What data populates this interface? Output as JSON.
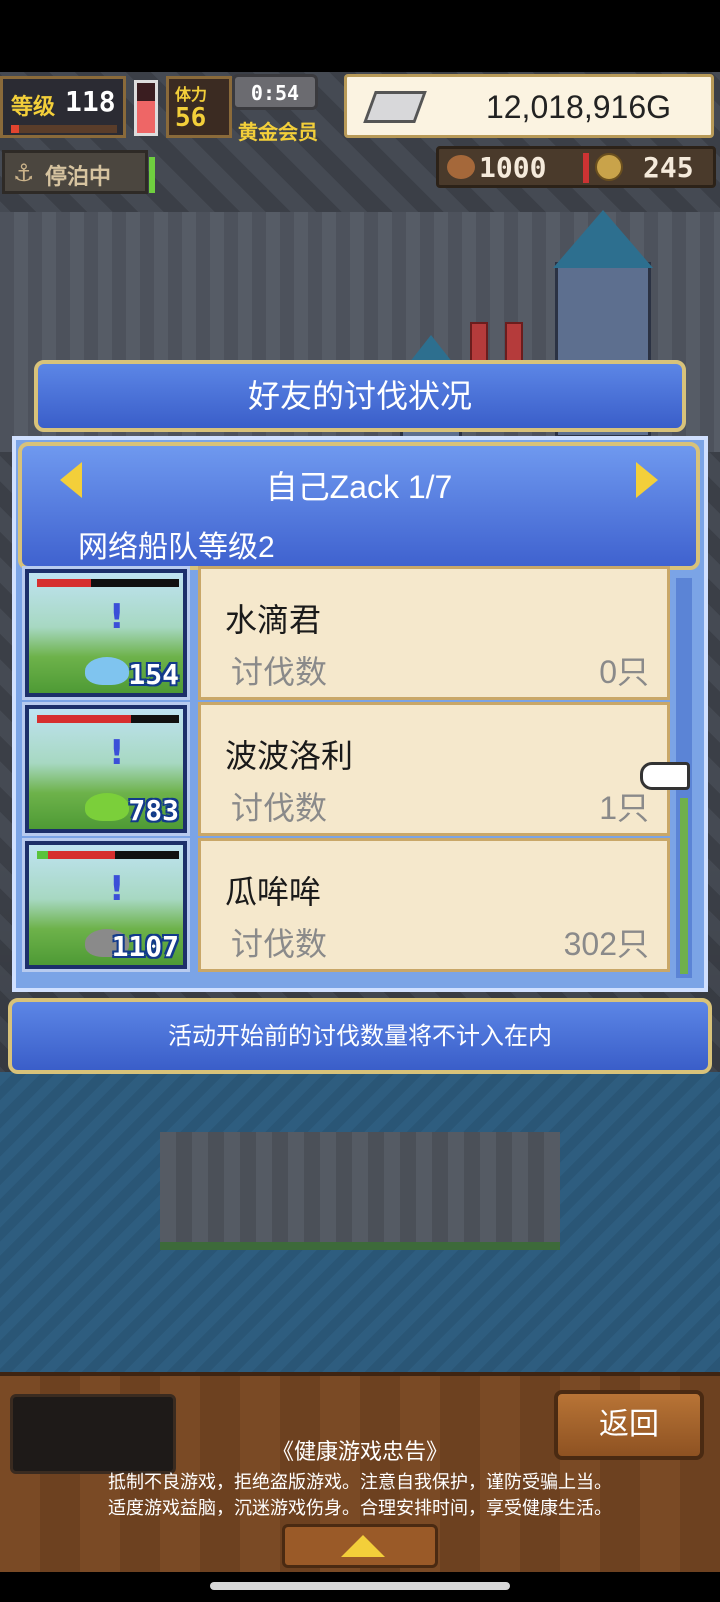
{
  "hud": {
    "level_label": "等级",
    "level": "118",
    "level_progress": 0.08,
    "stamina_level": 0.65,
    "vip_top": "体力",
    "vip_value": "56",
    "timer": "0:54",
    "membership": "黄金会员",
    "money": "12,018,916G"
  },
  "status": {
    "moored_icon": "anchor-icon",
    "moored": "停泊中"
  },
  "resources": {
    "food_icon": "fish-icon",
    "food": "1000",
    "coin_icon": "medal-icon",
    "coins": "245"
  },
  "dialog": {
    "title": "好友的讨伐状况",
    "player": "自己Zack 1/7",
    "fleet_level": "网络船队等级2",
    "rows": [
      {
        "name": "水滴君",
        "kill_label": "讨伐数",
        "count": "0只",
        "level": "154",
        "hp": 0.38,
        "monster_color": "#7fc4ef"
      },
      {
        "name": "波波洛利",
        "kill_label": "讨伐数",
        "count": "1只",
        "level": "783",
        "hp": 0.66,
        "monster_color": "#7bcf3a"
      },
      {
        "name": "瓜哞哞",
        "kill_label": "讨伐数",
        "count": "302只",
        "level": "1107",
        "hp": 0.55,
        "monster_color": "#8a8a8a"
      }
    ],
    "notice": "活动开始前的讨伐数量将不计入在内"
  },
  "footer": {
    "back": "返回",
    "advisory_title": "《健康游戏忠告》",
    "advisory_line1": "抵制不良游戏，拒绝盗版游戏。注意自我保护，谨防受骗上当。",
    "advisory_line2": "适度游戏益脑，沉迷游戏伤身。合理安排时间，享受健康生活。"
  }
}
